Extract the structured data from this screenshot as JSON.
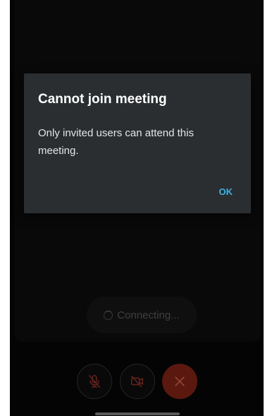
{
  "dialog": {
    "title": "Cannot join meeting",
    "message": "Only invited users can attend this meeting.",
    "ok_label": "OK"
  },
  "call": {
    "status_text": "Connecting..."
  },
  "controls": {
    "mic_icon": "mic-off-icon",
    "camera_icon": "camera-off-icon",
    "end_icon": "close-icon"
  },
  "colors": {
    "accent": "#3fb2e2",
    "dialog_bg": "#2a2e31",
    "end_call": "#6a1d12",
    "muted_red": "#7a2a22"
  }
}
